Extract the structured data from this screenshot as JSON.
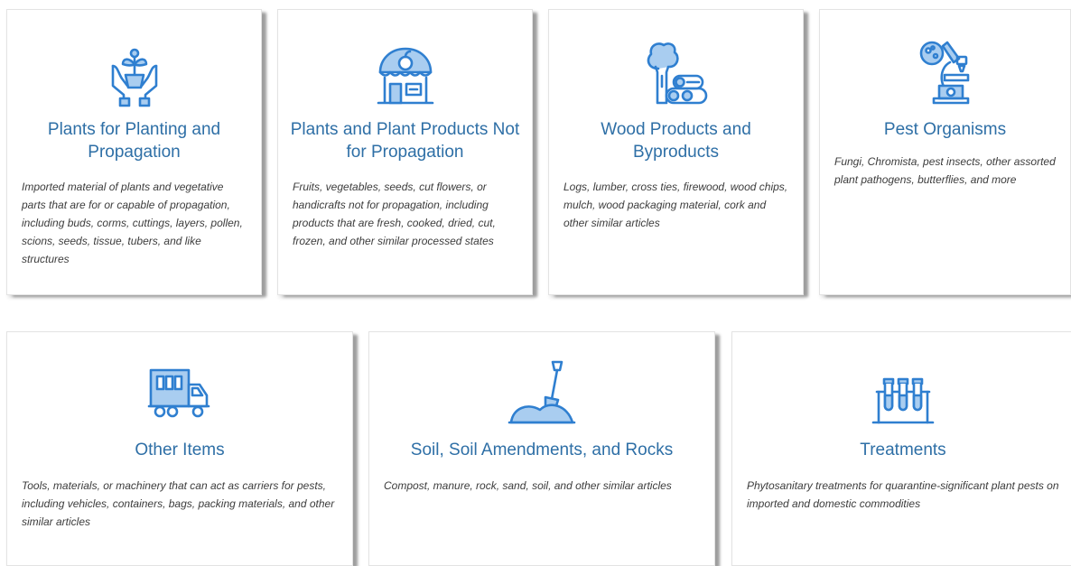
{
  "categories": [
    {
      "title": "Plants for Planting and Propagation",
      "description": "Imported material of plants and vegetative parts that are for or capable of propagation, including buds, corms, cuttings, layers, pollen, scions, seeds, tissue, tubers, and like structures",
      "icon": "hands-holding-plant-icon"
    },
    {
      "title": "Plants and Plant Products Not for Propagation",
      "description": "Fruits, vegetables, seeds, cut flowers, or handicrafts not for propagation, including products that are fresh, cooked, dried, cut, frozen, and other similar processed states",
      "icon": "fruit-shop-icon"
    },
    {
      "title": "Wood Products and Byproducts",
      "description": "Logs, lumber, cross ties, firewood, wood chips, mulch, wood packaging material, cork and other similar articles",
      "icon": "tree-and-logs-icon"
    },
    {
      "title": "Pest Organisms",
      "description": "Fungi, Chromista, pest insects, other assorted plant pathogens, butterflies, and more",
      "icon": "microscope-icon"
    },
    {
      "title": "Other Items",
      "description": "Tools, materials, or machinery that can act as carriers for pests, including vehicles, containers, bags, packing materials, and other similar articles",
      "icon": "cargo-truck-icon"
    },
    {
      "title": "Soil, Soil Amendments, and Rocks",
      "description": "Compost, manure, rock, sand, soil, and other similar articles",
      "icon": "shovel-in-soil-icon"
    },
    {
      "title": "Treatments",
      "description": "Phytosanitary treatments for quarantine-significant plant pests on imported and domestic commodities",
      "icon": "test-tubes-icon"
    }
  ],
  "colors": {
    "title": "#2e6fa6",
    "icon_stroke": "#2f7fd0",
    "icon_fill": "#a9cdf0",
    "description": "#3c3c3c"
  }
}
